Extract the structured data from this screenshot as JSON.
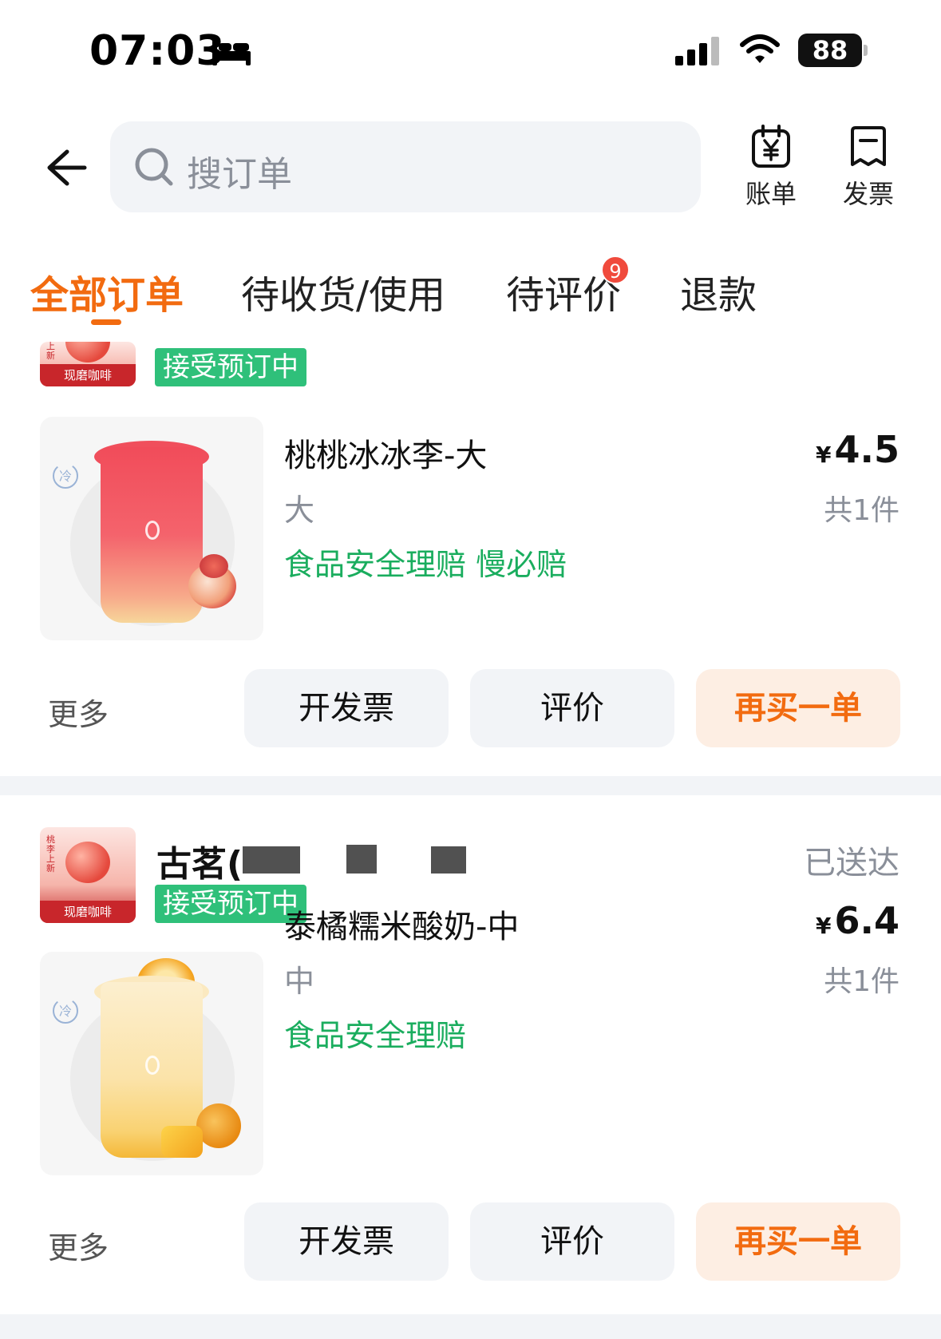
{
  "status_bar": {
    "time": "07:03",
    "battery": "88",
    "icons": [
      "bed-icon",
      "signal-icon",
      "wifi-icon",
      "battery-icon"
    ]
  },
  "header": {
    "back_icon": "arrow-left-icon",
    "search_placeholder": "搜订单",
    "bill_label": "账单",
    "invoice_label": "发票"
  },
  "tabs": [
    {
      "label": "全部订单",
      "active": true
    },
    {
      "label": "待收货/使用",
      "active": false
    },
    {
      "label": "待评价",
      "active": false,
      "badge": "9"
    },
    {
      "label": "退款",
      "active": false
    }
  ],
  "orders": [
    {
      "store_thumb_label": "现磨咖啡",
      "store_thumb_side": "上新",
      "store_tag": "接受预订中",
      "product": {
        "name": "桃桃冰冰李-大",
        "spec": "大",
        "tags": "食品安全理赔  慢必赔",
        "price_symbol": "¥",
        "price": "4.5",
        "count": "共1件"
      },
      "actions": {
        "more": "更多",
        "invoice": "开发票",
        "review": "评价",
        "reorder": "再买一单"
      }
    },
    {
      "store_thumb_label": "现磨咖啡",
      "store_thumb_side": "桃李上新",
      "store_name": "古茗(",
      "store_tag": "接受预订中",
      "status": "已送达",
      "product": {
        "name": "泰橘糯米酸奶-中",
        "spec": "中",
        "tags": "食品安全理赔",
        "price_symbol": "¥",
        "price": "6.4",
        "count": "共1件"
      },
      "actions": {
        "more": "更多",
        "invoice": "开发票",
        "review": "评价",
        "reorder": "再买一单"
      }
    }
  ],
  "colors": {
    "accent": "#f26b10",
    "green": "#1aad5e",
    "tag_green": "#2fc07a",
    "badge_red": "#f04a3c",
    "button_bg": "#f2f4f7",
    "primary_button_bg": "#fdeee3"
  }
}
